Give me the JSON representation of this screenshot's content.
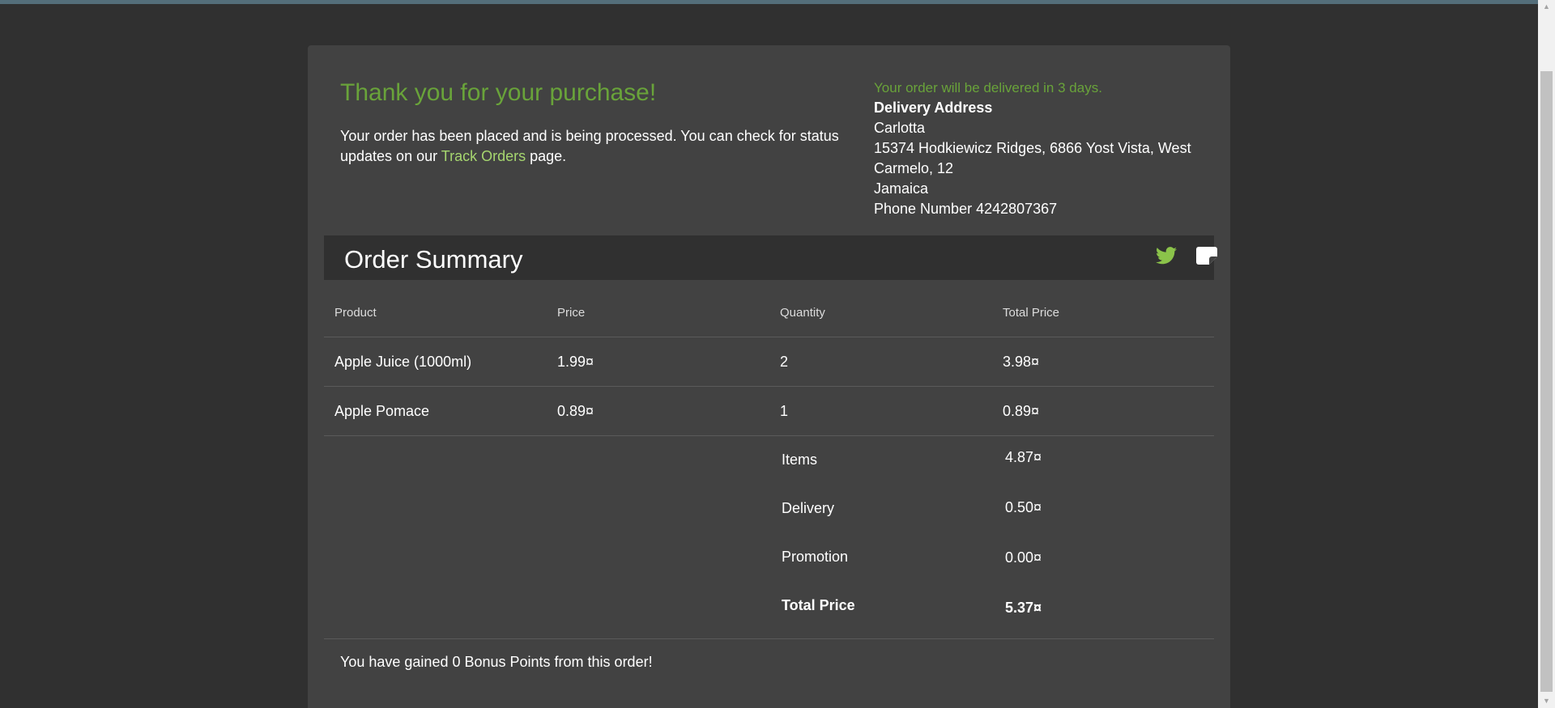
{
  "thanks": {
    "title": "Thank you for your purchase!",
    "text_before": "Your order has been placed and is being processed. You can check for status updates on our ",
    "link": "Track Orders",
    "text_after": " page."
  },
  "delivery": {
    "eta": "Your order will be delivered in 3 days.",
    "heading": "Delivery Address",
    "name": "Carlotta",
    "street": "15374 Hodkiewicz Ridges, 6866 Yost Vista, West Carmelo, 12",
    "country": "Jamaica",
    "phone": "Phone Number 4242807367"
  },
  "summary": {
    "title": "Order Summary",
    "icons": [
      "twitter-icon",
      "note-icon"
    ]
  },
  "table": {
    "headers": [
      "Product",
      "Price",
      "Quantity",
      "Total Price"
    ],
    "rows": [
      [
        "Apple Juice (1000ml)",
        "1.99¤",
        "2",
        "3.98¤"
      ],
      [
        "Apple Pomace",
        "0.89¤",
        "1",
        "0.89¤"
      ]
    ]
  },
  "totals": {
    "items_label": "Items",
    "items_value": "4.87¤",
    "delivery_label": "Delivery",
    "delivery_value": "0.50¤",
    "promotion_label": "Promotion",
    "promotion_value": "0.00¤",
    "total_label": "Total Price",
    "total_value": "5.37¤"
  },
  "bonus": "You have gained 0 Bonus Points from this order!",
  "colors": {
    "accent_green": "#69a33a",
    "link_green": "#a6d66f",
    "card": "#424242",
    "background": "#303030"
  }
}
